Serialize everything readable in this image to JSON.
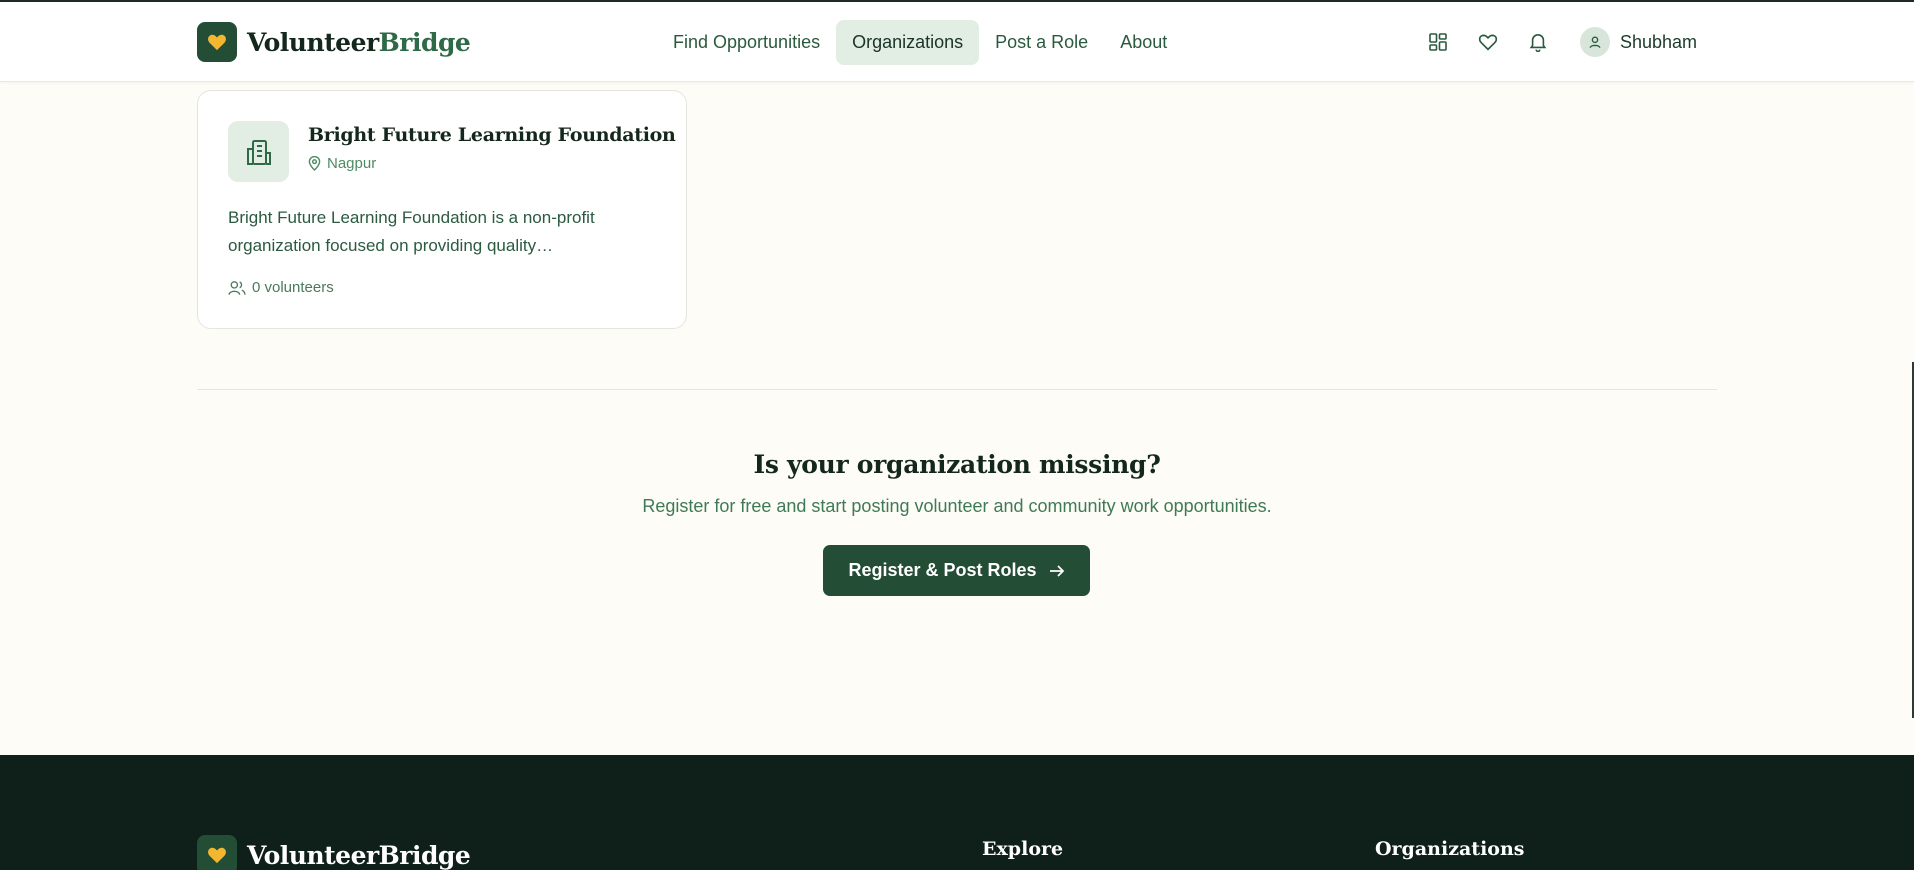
{
  "brand": {
    "name_part1": "Volunteer",
    "name_part2": "Bridge",
    "accent": "#234d35",
    "heart": "#f2b631"
  },
  "nav": {
    "items": [
      {
        "label": "Find Opportunities",
        "active": false
      },
      {
        "label": "Organizations",
        "active": true
      },
      {
        "label": "Post a Role",
        "active": false
      },
      {
        "label": "About",
        "active": false
      }
    ]
  },
  "header_icons": [
    "dashboard-icon",
    "heart-icon",
    "bell-icon"
  ],
  "user": {
    "name": "Shubham",
    "avatar_icon": "user-icon"
  },
  "organization_card": {
    "name": "Bright Future Learning Foundation",
    "location": "Nagpur",
    "description": "Bright Future Learning Foundation is a non-profit organization focused on providing quality…",
    "volunteers": "0 volunteers",
    "icon": "building-icon"
  },
  "cta": {
    "title": "Is your organization missing?",
    "subtitle": "Register for free and start posting volunteer and community work opportunities.",
    "button_label": "Register & Post Roles",
    "button_icon": "arrow-right-icon"
  },
  "footer": {
    "brand": "VolunteerBridge",
    "columns": [
      "Explore",
      "Organizations"
    ]
  }
}
